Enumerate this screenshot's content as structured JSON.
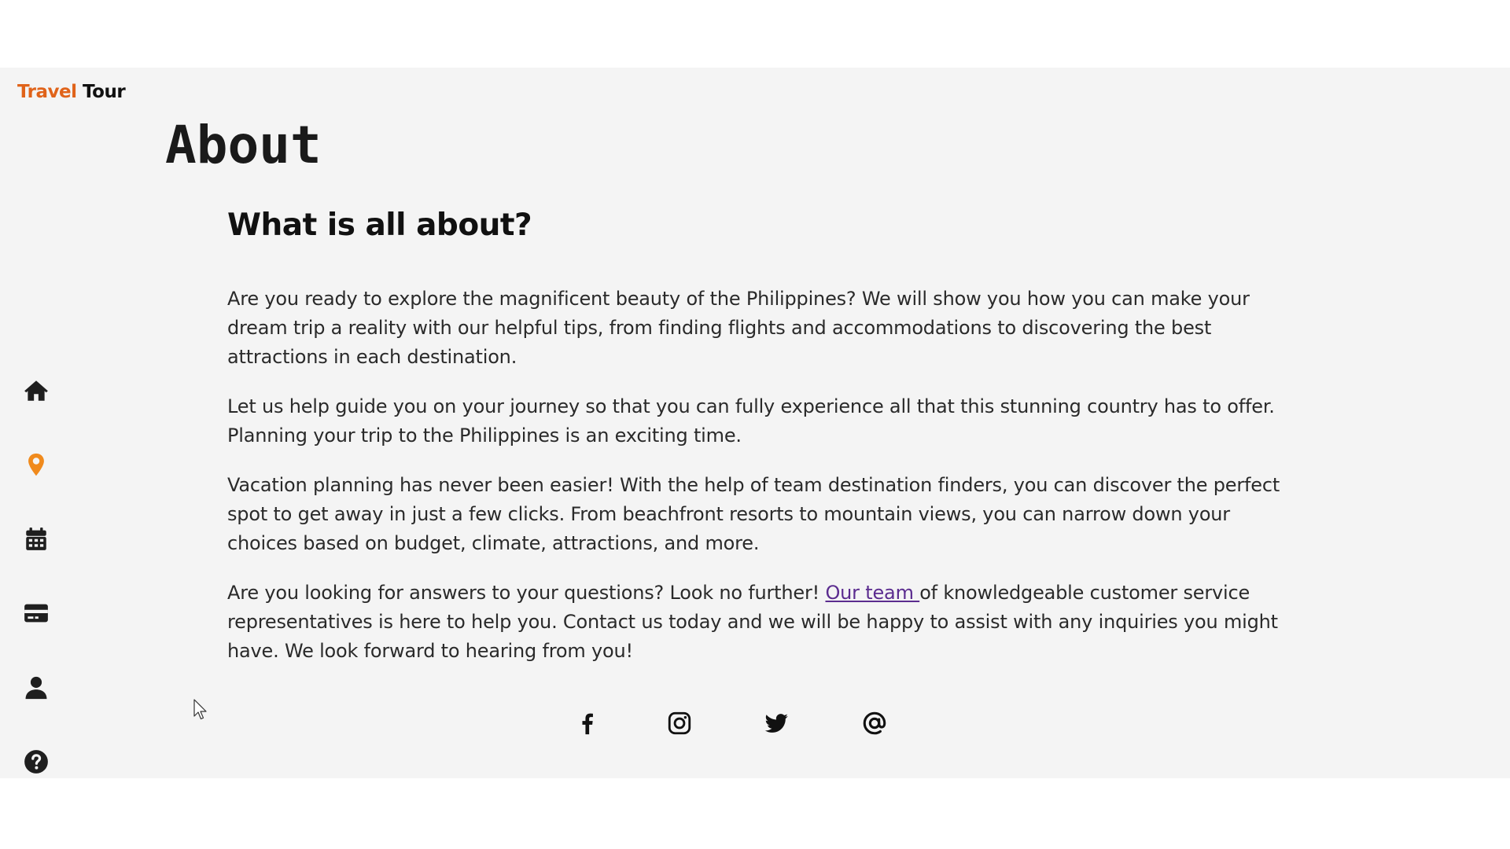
{
  "brand": {
    "part1": "Travel",
    "part2": "Tour"
  },
  "page": {
    "title": "About",
    "section_title": "What is all about?",
    "paragraphs": [
      "Are you ready to explore the magnificent beauty of the Philippines? We will show you how you can make your dream trip a reality with our helpful tips, from finding flights and accommodations to discovering the best attractions in each destination.",
      "Let us help guide you on your journey so that you can fully experience all that this stunning country has to offer. Planning your trip to the Philippines is an exciting time.",
      "Vacation planning has never been easier! With the help of team destination finders, you can discover the perfect spot to get away in just a few clicks. From beachfront resorts to mountain views, you can narrow down your choices based on budget, climate, attractions, and more."
    ],
    "last_paragraph": {
      "before_link": "Are you looking for answers to your questions? Look no further! ",
      "link": "Our team ",
      "after_link": "of knowledgeable customer service representatives is here to help you. Contact us today and we will be happy to assist with any inquiries you might have. We look forward to hearing from you!"
    }
  },
  "sidebar": {
    "items": [
      {
        "icon": "home-icon",
        "color": "#1f1f1f"
      },
      {
        "icon": "location-pin-icon",
        "color": "#f08a1c"
      },
      {
        "icon": "calendar-icon",
        "color": "#1f1f1f"
      },
      {
        "icon": "credit-card-icon",
        "color": "#1f1f1f"
      },
      {
        "icon": "user-icon",
        "color": "#1f1f1f"
      },
      {
        "icon": "help-icon",
        "color": "#1f1f1f"
      }
    ]
  },
  "social": {
    "items": [
      {
        "icon": "facebook-icon"
      },
      {
        "icon": "instagram-icon"
      },
      {
        "icon": "twitter-icon"
      },
      {
        "icon": "email-at-icon"
      }
    ]
  },
  "colors": {
    "accent": "#e0631a",
    "pin": "#f08a1c",
    "link": "#5b2c8f",
    "background": "#f4f4f4"
  }
}
